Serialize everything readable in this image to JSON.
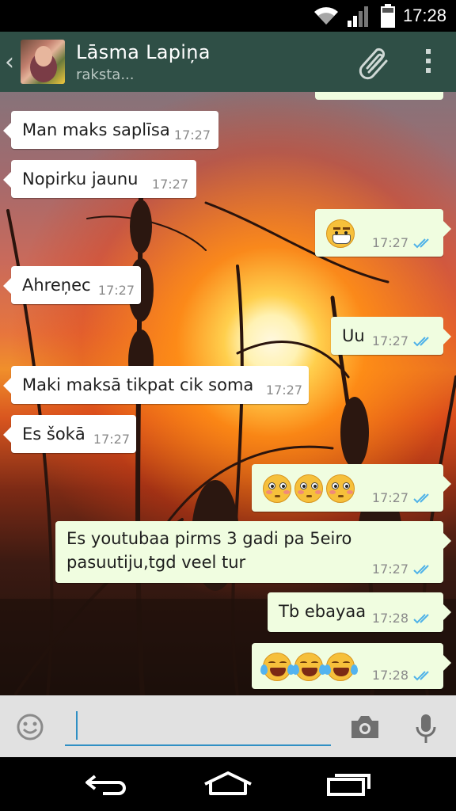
{
  "status_bar": {
    "time": "17:28"
  },
  "header": {
    "contact_name": "Lāsma Lapiņa",
    "contact_status": "raksta..."
  },
  "messages": [
    {
      "dir": "in",
      "text": "Man maks saplīsa",
      "time": "17:27"
    },
    {
      "dir": "in",
      "text": "Nopirku jaunu",
      "time": "17:27"
    },
    {
      "dir": "out",
      "text": "",
      "emoji": "grinning-face",
      "time": "17:27"
    },
    {
      "dir": "in",
      "text": "Ahreņec",
      "time": "17:27"
    },
    {
      "dir": "out",
      "text": "Uu",
      "time": "17:27"
    },
    {
      "dir": "in",
      "text": "Maki maksā tikpat cik soma",
      "time": "17:27"
    },
    {
      "dir": "in",
      "text": "Es šokā",
      "time": "17:27"
    },
    {
      "dir": "out",
      "text": "",
      "emoji": "flushed-face x3",
      "time": "17:27"
    },
    {
      "dir": "out",
      "text_line1": "Es youtubaa pirms 3 gadi pa 5eiro",
      "text_line2": "pasuutiju,tgd veel tur",
      "time": "17:27"
    },
    {
      "dir": "out",
      "text": "Tb ebayaa",
      "time": "17:28"
    },
    {
      "dir": "out",
      "text": "",
      "emoji": "tears-of-joy x3",
      "time": "17:28"
    }
  ],
  "input": {
    "value": ""
  },
  "colors": {
    "header_bg": "#2f4f46",
    "incoming_bubble": "#ffffff",
    "outgoing_bubble": "#f0fde0",
    "read_ticks": "#4fb2e8",
    "input_underline": "#2f8fc4"
  }
}
